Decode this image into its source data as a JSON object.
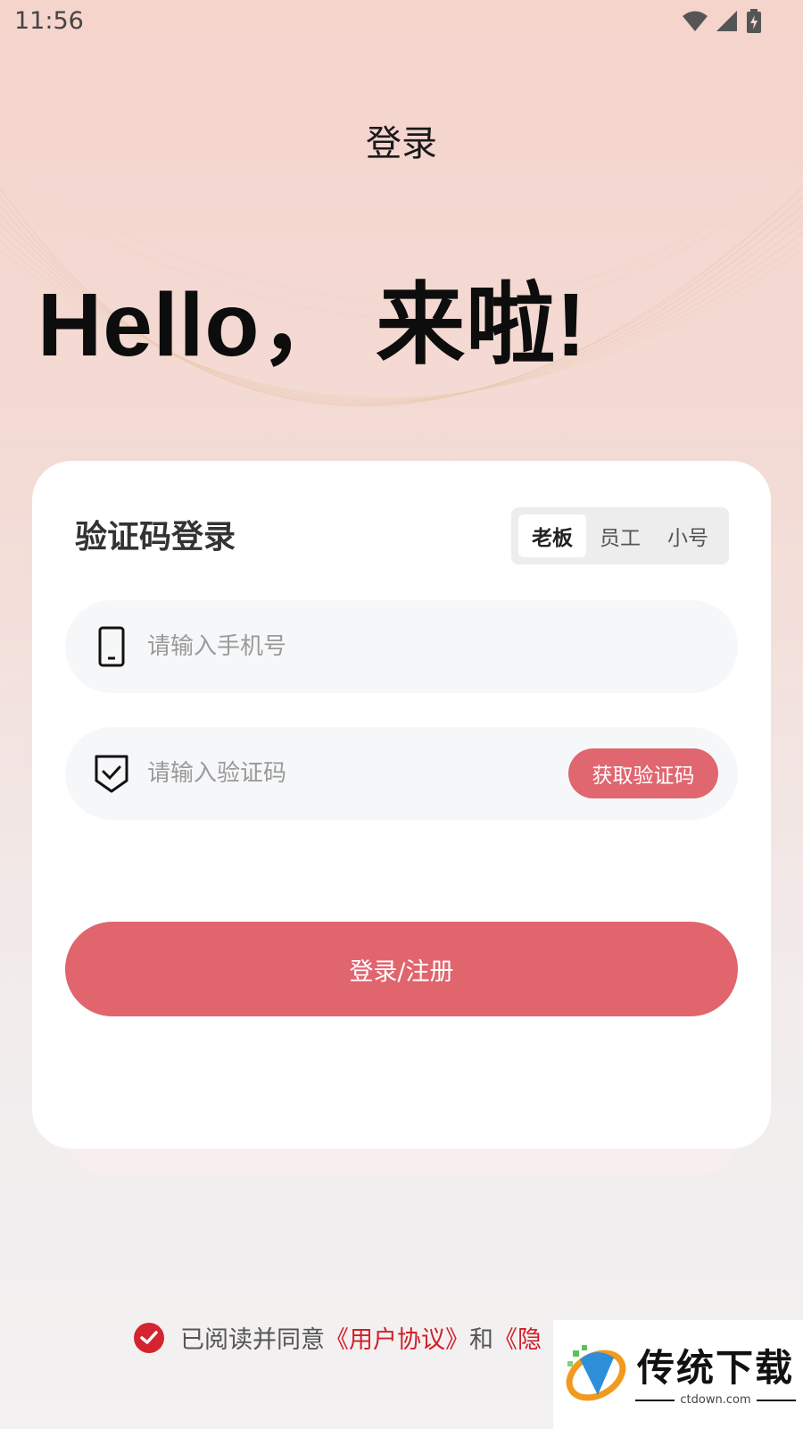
{
  "status_bar": {
    "time": "11:56",
    "icons": [
      "wifi-icon",
      "signal-icon",
      "battery-charging-icon"
    ]
  },
  "header": {
    "title": "登录"
  },
  "greeting": "Hello，  来啦!",
  "card": {
    "title": "验证码登录",
    "roles": [
      {
        "label": "老板",
        "active": true
      },
      {
        "label": "员工",
        "active": false
      },
      {
        "label": "小号",
        "active": false
      }
    ],
    "phone": {
      "placeholder": "请输入手机号",
      "icon": "phone-icon"
    },
    "code": {
      "placeholder": "请输入验证码",
      "icon": "shield-check-icon",
      "button": "获取验证码"
    },
    "submit": "登录/注册"
  },
  "agreement": {
    "prefix": "已阅读并同意",
    "user_agreement": "《用户协议》",
    "and": "和",
    "privacy_partial": "《隐"
  },
  "watermark": {
    "title": "传统下载",
    "domain": "ctdown.com"
  },
  "colors": {
    "accent": "#e0656d",
    "link": "#d0202a",
    "check": "#d3242f"
  }
}
